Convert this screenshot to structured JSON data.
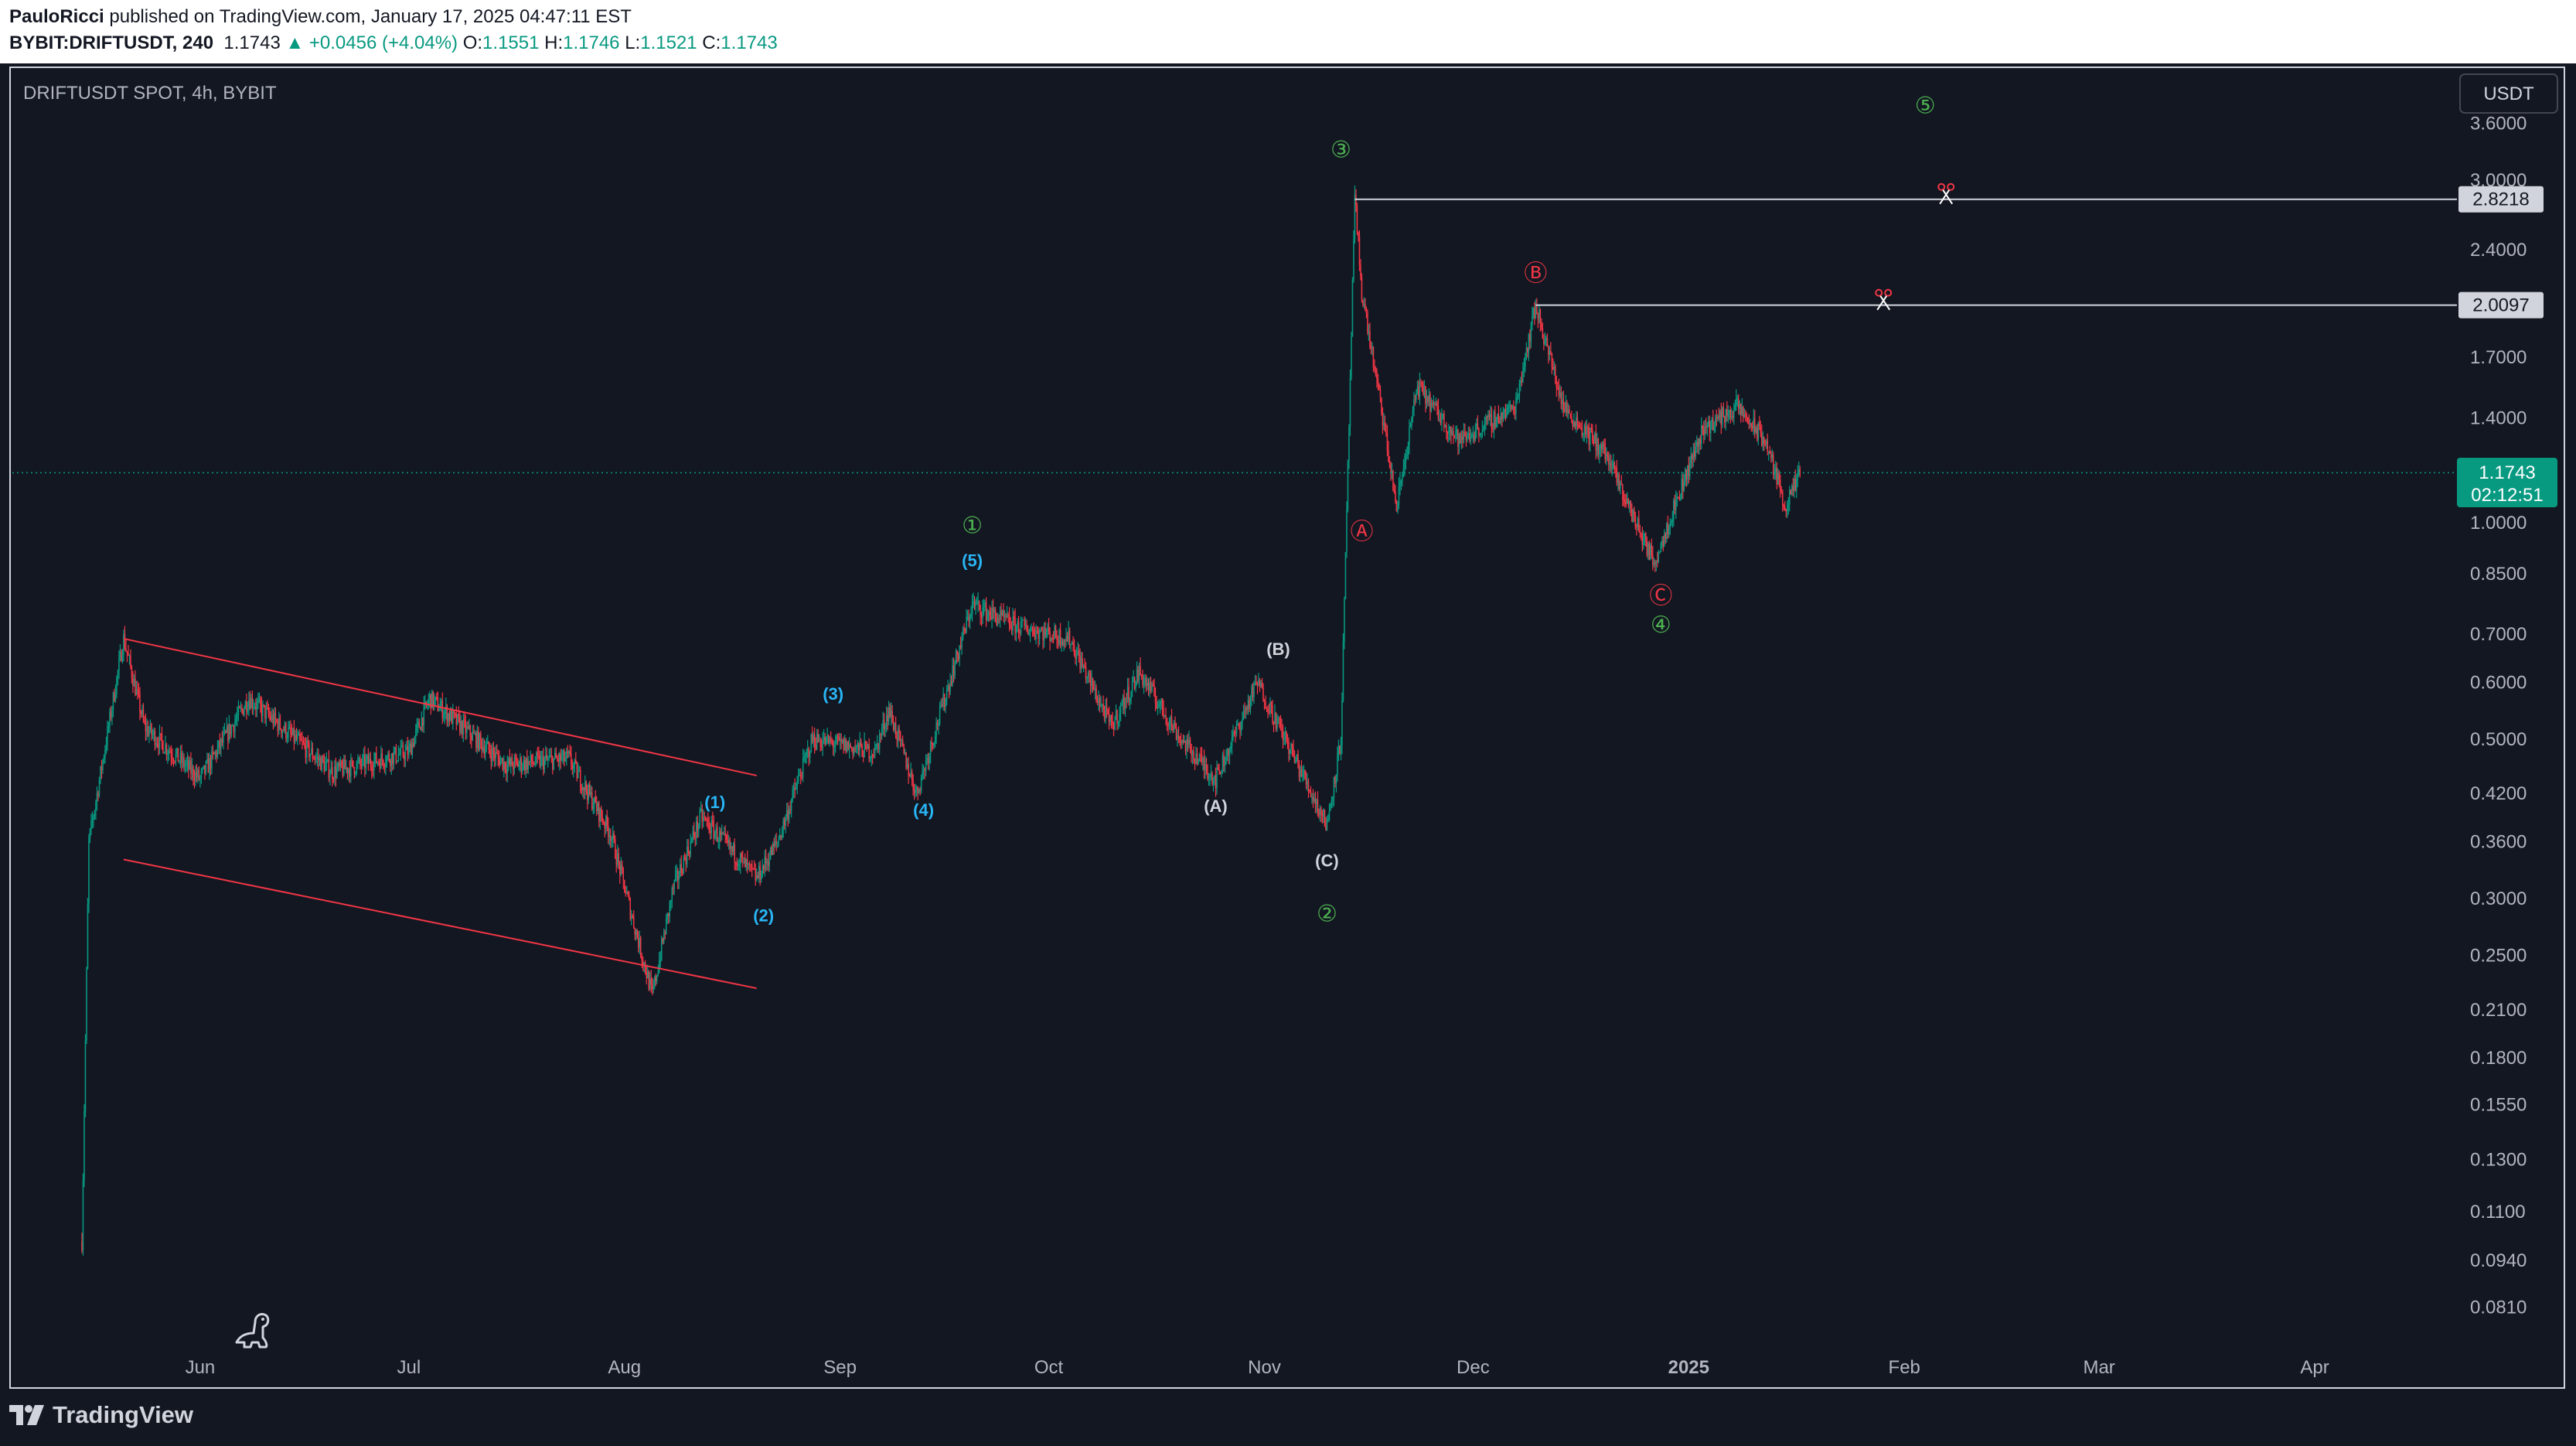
{
  "header": {
    "author": "PauloRicci",
    "published": "published on TradingView.com, January 17, 2025 04:47:11 EST",
    "symbol": "BYBIT:DRIFTUSDT, 240",
    "last": "1.1743",
    "change": "▲ +0.0456 (+4.04%)",
    "open_label": "O:",
    "open": "1.1551",
    "high_label": "H:",
    "high": "1.1746",
    "low_label": "L:",
    "low": "1.1521",
    "close_label": "C:",
    "close": "1.1743"
  },
  "chart_title": "DRIFTUSDT SPOT, 4h, BYBIT",
  "currency_button": "USDT",
  "price_tag": {
    "price": "1.1743",
    "countdown": "02:12:51"
  },
  "level_tags": [
    "2.8218",
    "2.0097"
  ],
  "footer": {
    "brand": "TradingView"
  },
  "colors": {
    "background": "#131722",
    "up": "#089981",
    "down": "#f23645",
    "channel": "#f23645",
    "wave_green": "#4caf50",
    "wave_red": "#f23645",
    "wave_cyan": "#29b6f6",
    "wave_white": "#d1d4dc"
  },
  "chart_data": {
    "type": "candlestick",
    "title": "DRIFTUSDT SPOT, 4h, BYBIT",
    "y_scale": "log",
    "y_ticks": [
      "3.6000",
      "3.0000",
      "2.4000",
      "1.7000",
      "1.4000",
      "1.0000",
      "0.8500",
      "0.7000",
      "0.6000",
      "0.5000",
      "0.4200",
      "0.3600",
      "0.3000",
      "0.2500",
      "0.2100",
      "0.1800",
      "0.1550",
      "0.1300",
      "0.1100",
      "0.0940",
      "0.0810"
    ],
    "x_ticks": [
      "Jun",
      "Jul",
      "Aug",
      "Sep",
      "Oct",
      "Nov",
      "Dec",
      "2025",
      "Feb",
      "Mar",
      "Apr"
    ],
    "x_range": [
      "2024-05-05",
      "2025-04-20"
    ],
    "last_price": 1.1743,
    "horizontal_levels": [
      2.8218,
      2.0097
    ],
    "price_path": [
      {
        "date": "2024-05-15",
        "price": 0.1
      },
      {
        "date": "2024-05-16",
        "price": 0.36
      },
      {
        "date": "2024-05-21",
        "price": 0.69
      },
      {
        "date": "2024-05-24",
        "price": 0.52
      },
      {
        "date": "2024-06-01",
        "price": 0.44
      },
      {
        "date": "2024-06-08",
        "price": 0.57
      },
      {
        "date": "2024-06-20",
        "price": 0.45
      },
      {
        "date": "2024-07-01",
        "price": 0.48
      },
      {
        "date": "2024-07-04",
        "price": 0.57
      },
      {
        "date": "2024-07-15",
        "price": 0.46
      },
      {
        "date": "2024-07-24",
        "price": 0.47
      },
      {
        "date": "2024-07-30",
        "price": 0.37
      },
      {
        "date": "2024-08-05",
        "price": 0.22
      },
      {
        "date": "2024-08-08",
        "price": 0.31
      },
      {
        "date": "2024-08-12",
        "price": 0.39
      },
      {
        "date": "2024-08-20",
        "price": 0.32
      },
      {
        "date": "2024-08-23",
        "price": 0.36
      },
      {
        "date": "2024-08-28",
        "price": 0.5
      },
      {
        "date": "2024-09-06",
        "price": 0.48
      },
      {
        "date": "2024-09-08",
        "price": 0.55
      },
      {
        "date": "2024-09-12",
        "price": 0.42
      },
      {
        "date": "2024-09-20",
        "price": 0.77
      },
      {
        "date": "2024-09-26",
        "price": 0.72
      },
      {
        "date": "2024-10-04",
        "price": 0.69
      },
      {
        "date": "2024-10-10",
        "price": 0.52
      },
      {
        "date": "2024-10-14",
        "price": 0.62
      },
      {
        "date": "2024-10-20",
        "price": 0.5
      },
      {
        "date": "2024-10-25",
        "price": 0.44
      },
      {
        "date": "2024-10-31",
        "price": 0.6
      },
      {
        "date": "2024-11-10",
        "price": 0.38
      },
      {
        "date": "2024-11-12",
        "price": 0.5
      },
      {
        "date": "2024-11-14",
        "price": 2.82
      },
      {
        "date": "2024-11-15",
        "price": 2.1
      },
      {
        "date": "2024-11-18",
        "price": 1.4
      },
      {
        "date": "2024-11-20",
        "price": 1.05
      },
      {
        "date": "2024-11-23",
        "price": 1.55
      },
      {
        "date": "2024-11-29",
        "price": 1.3
      },
      {
        "date": "2024-12-07",
        "price": 1.45
      },
      {
        "date": "2024-12-10",
        "price": 2.01
      },
      {
        "date": "2024-12-14",
        "price": 1.45
      },
      {
        "date": "2024-12-20",
        "price": 1.25
      },
      {
        "date": "2024-12-27",
        "price": 0.88
      },
      {
        "date": "2025-01-03",
        "price": 1.35
      },
      {
        "date": "2025-01-08",
        "price": 1.45
      },
      {
        "date": "2025-01-12",
        "price": 1.3
      },
      {
        "date": "2025-01-15",
        "price": 1.05
      },
      {
        "date": "2025-01-17",
        "price": 1.17
      }
    ],
    "trend_lines": [
      {
        "name": "channel-upper",
        "from": {
          "date": "2024-05-21",
          "price": 0.69
        },
        "to": {
          "date": "2024-08-20",
          "price": 0.445
        }
      },
      {
        "name": "channel-lower",
        "from": {
          "date": "2024-05-21",
          "price": 0.34
        },
        "to": {
          "date": "2024-08-20",
          "price": 0.225
        }
      }
    ],
    "annotations": [
      {
        "label": "①",
        "date": "2024-09-20",
        "price": 0.99,
        "color": "green"
      },
      {
        "label": "②",
        "date": "2024-11-10",
        "price": 0.285,
        "color": "green"
      },
      {
        "label": "③",
        "date": "2024-11-12",
        "price": 3.3,
        "color": "green"
      },
      {
        "label": "④",
        "date": "2024-12-28",
        "price": 0.72,
        "color": "green"
      },
      {
        "label": "⑤",
        "date": "2025-02-04",
        "price": 3.8,
        "color": "green"
      },
      {
        "label": "Ⓐ",
        "date": "2024-11-15",
        "price": 0.97,
        "color": "red"
      },
      {
        "label": "Ⓑ",
        "date": "2024-12-10",
        "price": 2.22,
        "color": "red"
      },
      {
        "label": "Ⓒ",
        "date": "2024-12-28",
        "price": 0.79,
        "color": "red"
      },
      {
        "label": "(1)",
        "date": "2024-08-14",
        "price": 0.41,
        "color": "cyan"
      },
      {
        "label": "(2)",
        "date": "2024-08-21",
        "price": 0.285,
        "color": "cyan"
      },
      {
        "label": "(3)",
        "date": "2024-08-31",
        "price": 0.58,
        "color": "cyan"
      },
      {
        "label": "(4)",
        "date": "2024-09-13",
        "price": 0.4,
        "color": "cyan"
      },
      {
        "label": "(5)",
        "date": "2024-09-20",
        "price": 0.89,
        "color": "cyan"
      },
      {
        "label": "(A)",
        "date": "2024-10-25",
        "price": 0.405,
        "color": "white"
      },
      {
        "label": "(B)",
        "date": "2024-11-03",
        "price": 0.67,
        "color": "white"
      },
      {
        "label": "(C)",
        "date": "2024-11-10",
        "price": 0.34,
        "color": "white"
      }
    ]
  }
}
